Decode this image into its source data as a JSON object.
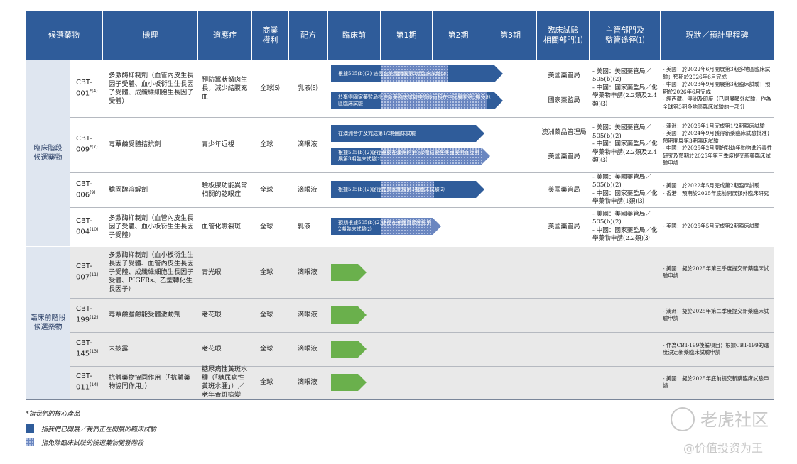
{
  "headers": [
    "候選藥物",
    "機理",
    "適應症",
    "商業\n權利",
    "配方",
    "臨床前",
    "第1期",
    "第2期",
    "第3期",
    "臨床試驗\n相關部門⑴",
    "主管部門及\n監管途徑⑴",
    "現狀／預計里程碑"
  ],
  "stages": {
    "clinical": "臨床階段\n候選藥物",
    "preclinical": "臨床前階段\n候選藥物"
  },
  "rows": [
    {
      "cbt": "CBT-\n001",
      "sup": "*(4)",
      "mech": "多激酶抑制劑（血管內皮生長因子受體、血小板衍生生長因子受體、成纖維細胞生長因子受體）",
      "ind": "預防翼狀胬肉生長，減少結膜充血",
      "rights": "全球⑸",
      "form": "乳液⑹",
      "arrows": [
        "根據505(b)(2) 途徑在美國開展第3期臨床試驗⑵",
        "於獲得國家藥監局批准新藥臨床試驗申請後直接在中國展開第3期多地區臨床試驗"
      ],
      "dept": [
        "美國藥管局",
        "國家藥監局"
      ],
      "reg": "- 美國：美國藥管局／505(b)(2)\n- 中國：國家藥監局／化學藥物申請(2.2類及2.4類)⑶",
      "status": "- 美國：於2022年6月開展第3期多地區臨床試驗；預期於2026年6月完成\n- 中國：於2023年9月開展第3期臨床試驗；預期於2026年6月完成\n- 經西藏、澳洲及印度（已開展額外試驗，作為全球第3期多地區臨床試驗的一部分"
    },
    {
      "cbt": "CBT-\n009",
      "sup": "*(7)",
      "mech": "毒蕈鹼受體拮抗劑",
      "ind": "青少年近視",
      "rights": "全球",
      "form": "滴眼液",
      "arrows": [
        "在澳洲合併及完成第1/2期臨床試驗",
        "根據505(b)(2)途徑基於在澳洲的第1/2期結果在美國展開直接開展第3期臨床試驗⑵"
      ],
      "dept": [
        "澳洲藥品管理局",
        "美國藥管局"
      ],
      "reg": "- 美國：美國藥管局／505(b)(2)\n- 中國：國家藥監局／化學藥物申請(2.2類及2.4類)⑶",
      "status": "- 澳洲：於2025年1月完成第1/2期臨床試驗\n- 美國：於2024年9月獲得新藥臨床試驗批准；預期開展第3期臨床試驗\n- 中國：於2025年2月開始對幼年動物進行毒性研究及預期於2025年第三季度提交新藥臨床試驗申請"
    },
    {
      "cbt": "CBT-\n006",
      "sup": "(9)",
      "mech": "膽固醇溶解劑",
      "ind": "瞼板腺功能異常相關的乾眼症",
      "rights": "全球",
      "form": "滴眼液",
      "arrows": [
        "根據505(b)(2)途徑在美國開展第3期臨床試驗⑵"
      ],
      "dept": [
        "美國藥管局"
      ],
      "reg": "- 美國：美國藥管局／505(b)(2)\n- 中國：國家藥監局／化學藥物申請(1類)⑶",
      "status": "- 美國：於2022年5月完成第2期臨床試驗\n- 香港：預期於2025年底前開展額外臨床研究"
    },
    {
      "cbt": "CBT-\n004",
      "sup": "(10)",
      "mech": "多激酶抑制劑（血管內皮生長因子受體、血小板衍生生長因子受體）",
      "ind": "血管化瞼裂斑",
      "rights": "全球",
      "form": "乳液",
      "arrows": [
        "預期根據505(b)(2)途徑在美國直接開展第2期臨床試驗⑵"
      ],
      "dept": [
        "美國藥管局"
      ],
      "reg": "- 美國：美國藥管局／505(b)(2)\n- 中國：國家藥監局／化學藥物申請(2.2類)⑶",
      "status": "- 美國：於2025年5月完成第2期臨床試驗"
    },
    {
      "cbt": "CBT-\n007",
      "sup": "(11)",
      "mech": "多激酶抑制劑（血小板衍生生長因子受體、血管內皮生長因子受體、成纖維細胞生長因子受體、PIGFRs、乙型轉化生長因子）",
      "ind": "青光眼",
      "rights": "全球",
      "form": "滴眼液",
      "status": "- 美國：擬於2025年第三季度提交新藥臨床試驗申請"
    },
    {
      "cbt": "CBT-\n199",
      "sup": "(12)",
      "mech": "毒蕈鹼膽鹼能受體激動劑",
      "ind": "老花眼",
      "rights": "全球",
      "form": "滴眼液",
      "status": "- 澳洲：擬於2025年第二季度提交新藥臨床試驗申請"
    },
    {
      "cbt": "CBT-\n145",
      "sup": "(13)",
      "mech": "未披露",
      "ind": "老花眼",
      "rights": "全球",
      "form": "滴眼液",
      "status": "- 作為CBT-199後備項目；根據CBT-199的進度決定新藥臨床試驗申請"
    },
    {
      "cbt": "CBT-\n011",
      "sup": "(14)",
      "mech": "抗體藥物協同作用（「抗體藥物協同作用」）",
      "ind": "糖尿病性黃斑水腫（「糖尿病性黃斑水腫」）／老年黃斑病變",
      "rights": "全球",
      "form": "滴眼液",
      "status": "- 美國：擬於2025年底前提交新藥臨床試驗申請"
    }
  ],
  "legend": {
    "core": "*指我們的核心產品",
    "conducted": "指我們已開展／我們正在開展的臨床試驗",
    "exempt": "指免除臨床試驗的候選藥物開發階段"
  },
  "watermark": {
    "logo": "老虎社区",
    "handle": "@价值投资为王"
  },
  "colors": {
    "header": "#2f5c9a",
    "arrow": "#2f5c9a",
    "preclinical_arrow": "#6ab04c",
    "stage_bg": "#dfe6f0"
  }
}
